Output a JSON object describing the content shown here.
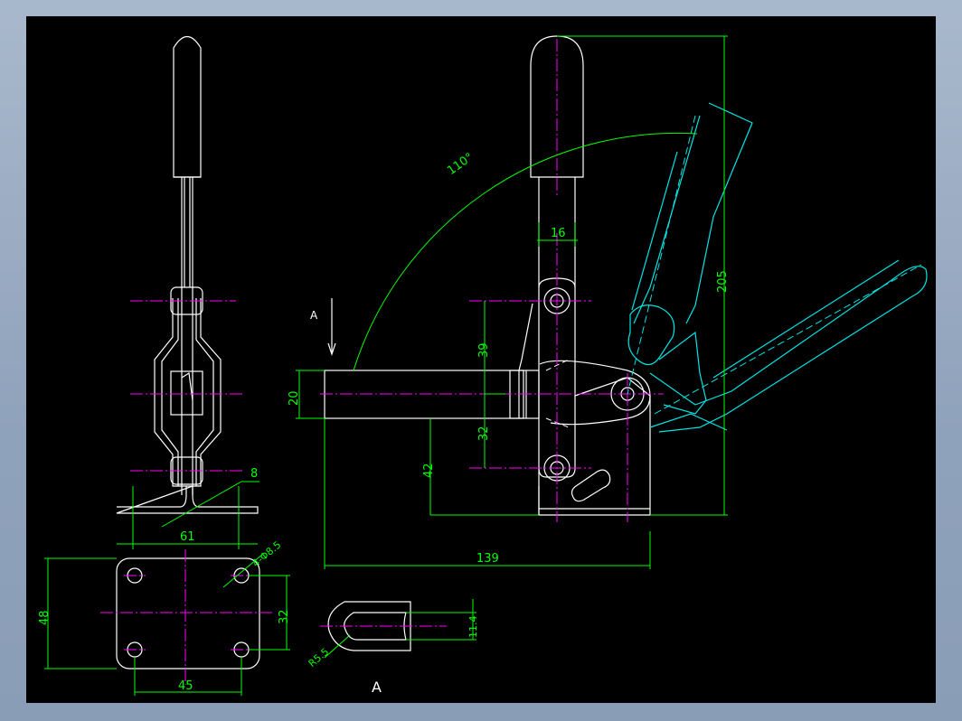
{
  "drawing": {
    "view_label_marker": "A",
    "view_label_title": "A",
    "dims": {
      "angle": "110°",
      "overall_height": "205",
      "handle_width": "16",
      "pivot_v1": "39",
      "pivot_v2": "32",
      "bar_height": "20",
      "base_height": "42",
      "overall_length": "139",
      "side_width": "61",
      "side_thickness": "8",
      "hole_callout": "4-Φ8.5",
      "plate_height": "48",
      "hole_spacing_v": "32",
      "hole_spacing_h": "45",
      "slot_width": "11.4",
      "slot_radius": "R5.5"
    }
  }
}
